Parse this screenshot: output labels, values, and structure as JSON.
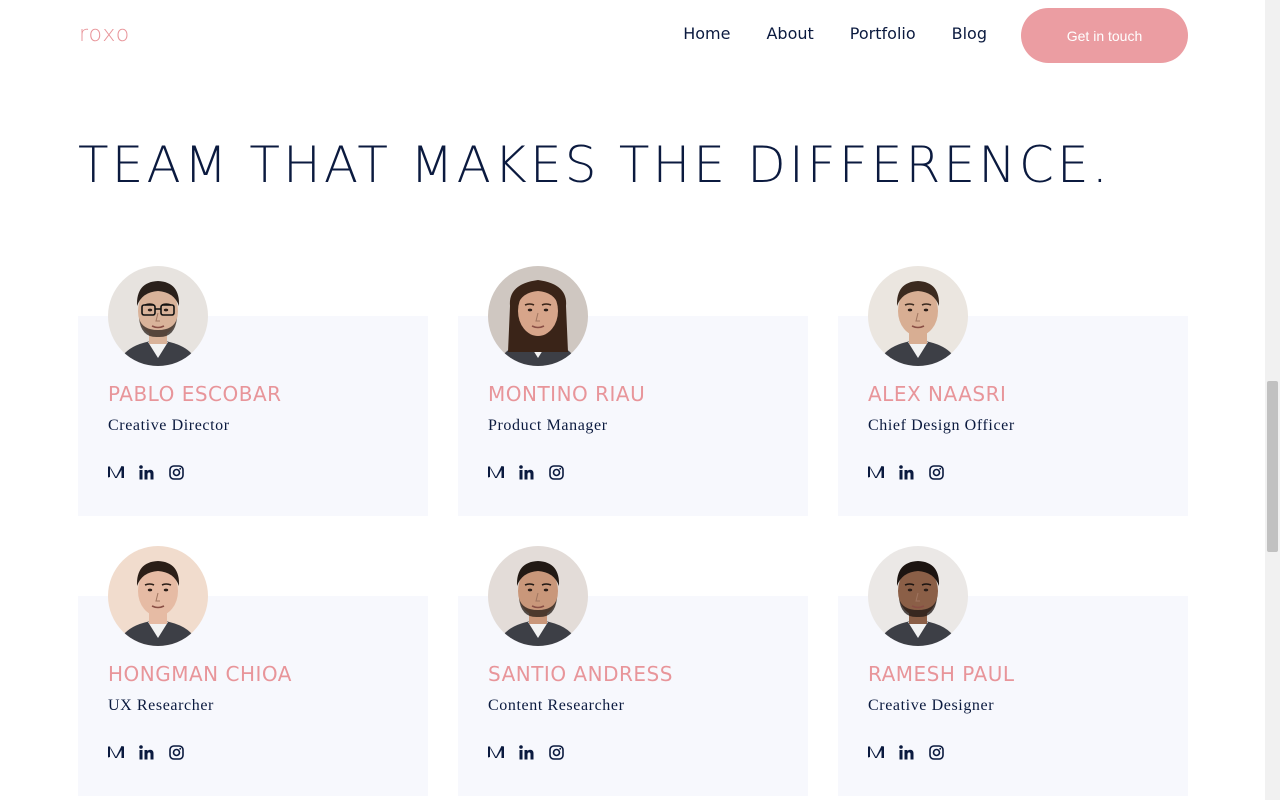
{
  "brand": {
    "logo": "roxo",
    "accent": "#e8959a",
    "dark": "#0b1a3f",
    "card_bg": "#f7f8fd"
  },
  "nav": {
    "items": [
      "Home",
      "About",
      "Portfolio",
      "Blog"
    ],
    "cta": "Get in touch"
  },
  "section": {
    "title": "TEAM THAT MAKES THE DIFFERENCE."
  },
  "team": [
    {
      "name": "PABLO ESCOBAR",
      "role": "Creative Director",
      "skin": "#d9b39a",
      "hair": "#2a201b",
      "bg": "#e7e3df",
      "glasses": true,
      "beard": true
    },
    {
      "name": "MONTINO RIAU",
      "role": "Product Manager",
      "skin": "#d7a58a",
      "hair": "#3a2418",
      "bg": "#cfc7c1",
      "glasses": false,
      "beard": false,
      "long_hair": true
    },
    {
      "name": "ALEX NAASRI",
      "role": "Chief Design Officer",
      "skin": "#d8ae93",
      "hair": "#3b2a1f",
      "bg": "#ebe6e0",
      "glasses": false,
      "beard": false
    },
    {
      "name": "HONGMAN CHIOA",
      "role": "UX Researcher",
      "skin": "#e6bba4",
      "hair": "#2b1e17",
      "bg": "#f1dccd",
      "glasses": false,
      "beard": false
    },
    {
      "name": "SANTIO ANDRESS",
      "role": "Content Researcher",
      "skin": "#c9977a",
      "hair": "#221914",
      "bg": "#e3dcd8",
      "glasses": false,
      "beard": true
    },
    {
      "name": "RAMESH PAUL",
      "role": "Creative Designer",
      "skin": "#8b5f47",
      "hair": "#1c1411",
      "bg": "#ebe8e6",
      "glasses": false,
      "beard": true
    }
  ],
  "social_icons": [
    "medium-icon",
    "linkedin-icon",
    "instagram-icon"
  ]
}
